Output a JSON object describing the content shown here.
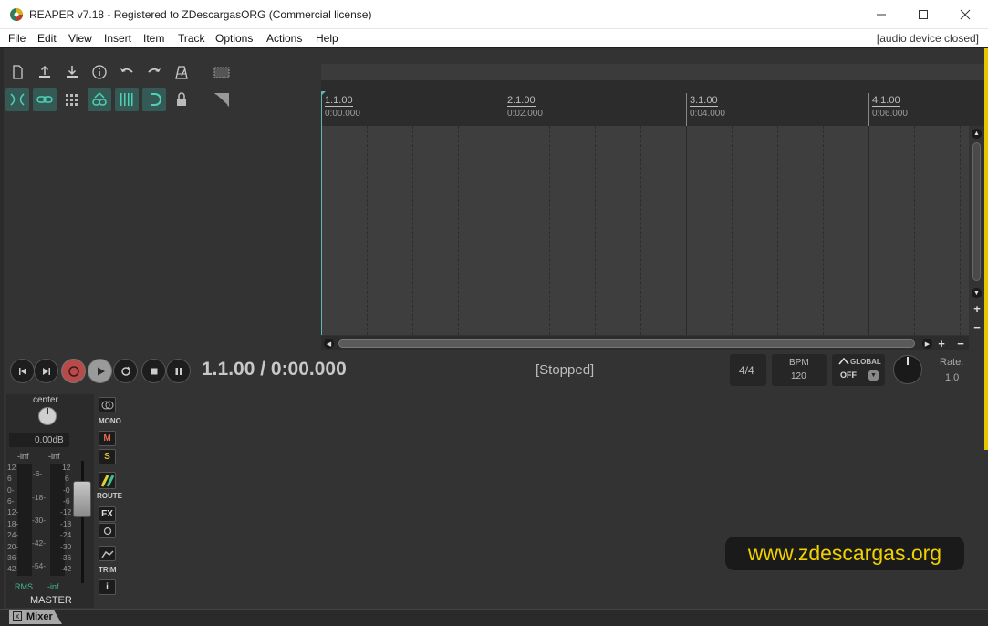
{
  "window": {
    "title": "REAPER v7.18 - Registered to ZDescargasORG (Commercial license)",
    "minimize": "—",
    "maximize": "☐",
    "close": "✕"
  },
  "menu": {
    "items": [
      "File",
      "Edit",
      "View",
      "Insert",
      "Item",
      "Track",
      "Options",
      "Actions",
      "Help"
    ],
    "audio_status": "[audio device closed]"
  },
  "toolbar": {
    "row1": [
      "new-project-icon",
      "save-upload-icon",
      "save-download-icon",
      "info-icon",
      "undo-icon",
      "redo-icon",
      "metronome-icon"
    ],
    "row2": [
      "ripple-edit-icon",
      "link-icon",
      "grid-icon",
      "item-grouping-icon",
      "snap-grid-icon",
      "loop-icon",
      "lock-icon"
    ],
    "right": [
      "marquee-icon",
      "envelope-icon"
    ]
  },
  "ruler": {
    "marks": [
      {
        "bar": "1.1.00",
        "time": "0:00.000"
      },
      {
        "bar": "2.1.00",
        "time": "0:02.000"
      },
      {
        "bar": "3.1.00",
        "time": "0:04.000"
      },
      {
        "bar": "4.1.00",
        "time": "0:06.000"
      }
    ]
  },
  "transport": {
    "position": "1.1.00 / 0:00.000",
    "status": "[Stopped]",
    "time_signature": "4/4",
    "bpm_label": "BPM",
    "bpm_value": "120",
    "global_label": "GLOBAL",
    "global_state": "OFF",
    "rate_label": "Rate:",
    "rate_value": "1.0"
  },
  "master": {
    "pan": "center",
    "volume": "0.00dB",
    "peak_left": "-inf",
    "peak_right": "-inf",
    "scale_left": [
      "12",
      "6",
      "0-",
      "6-",
      "12-",
      "18-",
      "24-",
      "20-",
      "36-",
      "42-"
    ],
    "scale_mid": [
      "-6-",
      "-18-",
      "-30-",
      "-42-",
      "-54-"
    ],
    "scale_right": [
      "12",
      "6",
      "-0",
      "-6",
      "-12",
      "-18",
      "-24",
      "-30",
      "-36",
      "-42"
    ],
    "rms_label": "RMS",
    "rms_value": "-inf",
    "name": "MASTER",
    "mono_label": "MONO",
    "mute": "M",
    "solo": "S",
    "route_label": "ROUTE",
    "fx": "FX",
    "trim_label": "TRIM",
    "info": "i"
  },
  "watermark": "www.zdescargas.org",
  "mixer_tab": {
    "label": "Mixer",
    "close": "x"
  },
  "colors": {
    "accent_teal": "#355a55",
    "record_red": "#c0392b",
    "watermark_yellow": "#f0d000"
  }
}
